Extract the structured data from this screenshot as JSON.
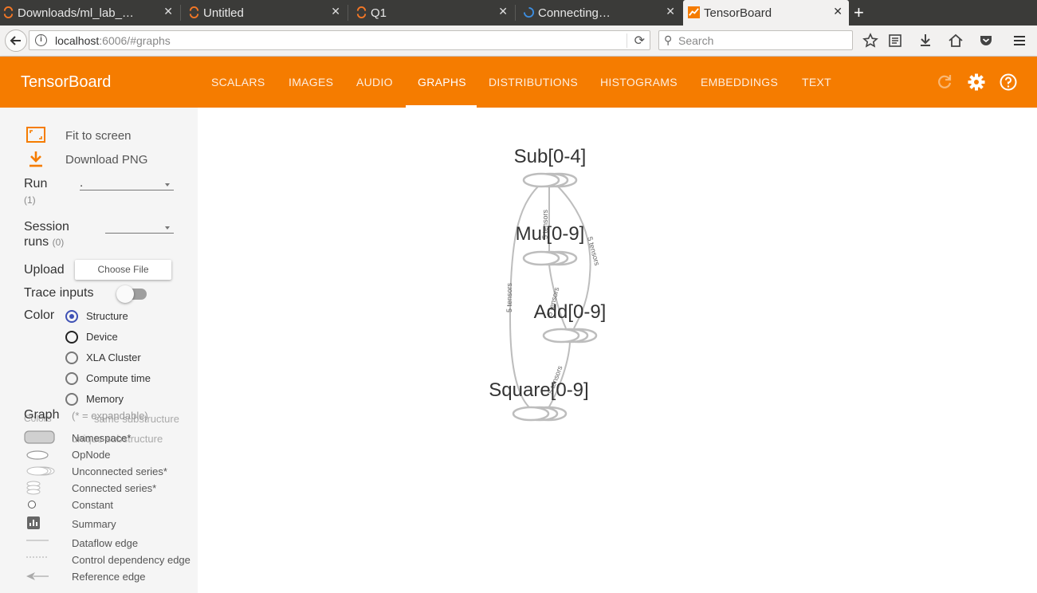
{
  "browser": {
    "tabs": [
      {
        "label": "Downloads/ml_lab_…"
      },
      {
        "label": "Untitled"
      },
      {
        "label": "Q1"
      },
      {
        "label": "Connecting…"
      },
      {
        "label": "TensorBoard"
      }
    ],
    "new_tab": "+",
    "url_host": "localhost",
    "url_path": ":6006/#graphs",
    "search_placeholder": "Search"
  },
  "tensorboard": {
    "title": "TensorBoard",
    "nav_tabs": [
      "SCALARS",
      "IMAGES",
      "AUDIO",
      "GRAPHS",
      "DISTRIBUTIONS",
      "HISTOGRAMS",
      "EMBEDDINGS",
      "TEXT"
    ],
    "active_tab": "GRAPHS",
    "accent_color": "#f57c00"
  },
  "sidebar": {
    "fit_to_screen": "Fit to screen",
    "download_png": "Download PNG",
    "run_label": "Run",
    "run_count": "(1)",
    "run_value": ".",
    "session_label_1": "Session",
    "session_label_2": "runs",
    "session_count": "(0)",
    "upload_label": "Upload",
    "choose_file": "Choose File",
    "trace_inputs": "Trace inputs",
    "trace_inputs_on": false,
    "color_label": "Color",
    "color_options": [
      {
        "label": "Structure",
        "checked": true
      },
      {
        "label": "Device",
        "checked": false
      },
      {
        "label": "XLA Cluster",
        "checked": false
      },
      {
        "label": "Compute time",
        "checked": false
      },
      {
        "label": "Memory",
        "checked": false
      }
    ],
    "graph_label": "Graph",
    "graph_note": "(* = expandable)",
    "overlap_colors": "Colors",
    "overlap_same": "same substructure",
    "overlap_unique": "unique substructure",
    "legend": {
      "namespace": "Namespace*",
      "opnode": "OpNode",
      "unconnected": "Unconnected series*",
      "connected": "Connected series*",
      "constant": "Constant",
      "summary": "Summary",
      "dataflow": "Dataflow edge",
      "control": "Control dependency edge",
      "reference": "Reference edge"
    }
  },
  "graph": {
    "nodes": [
      {
        "label": "Sub[0-4]"
      },
      {
        "label": "Mul[0-9]"
      },
      {
        "label": "Add[0-9]"
      },
      {
        "label": "Square[0-9]"
      }
    ],
    "edge_labels": [
      "5 tensors",
      "5 tensors",
      "5 tensors",
      "5 tensors",
      "5 tensors"
    ]
  }
}
